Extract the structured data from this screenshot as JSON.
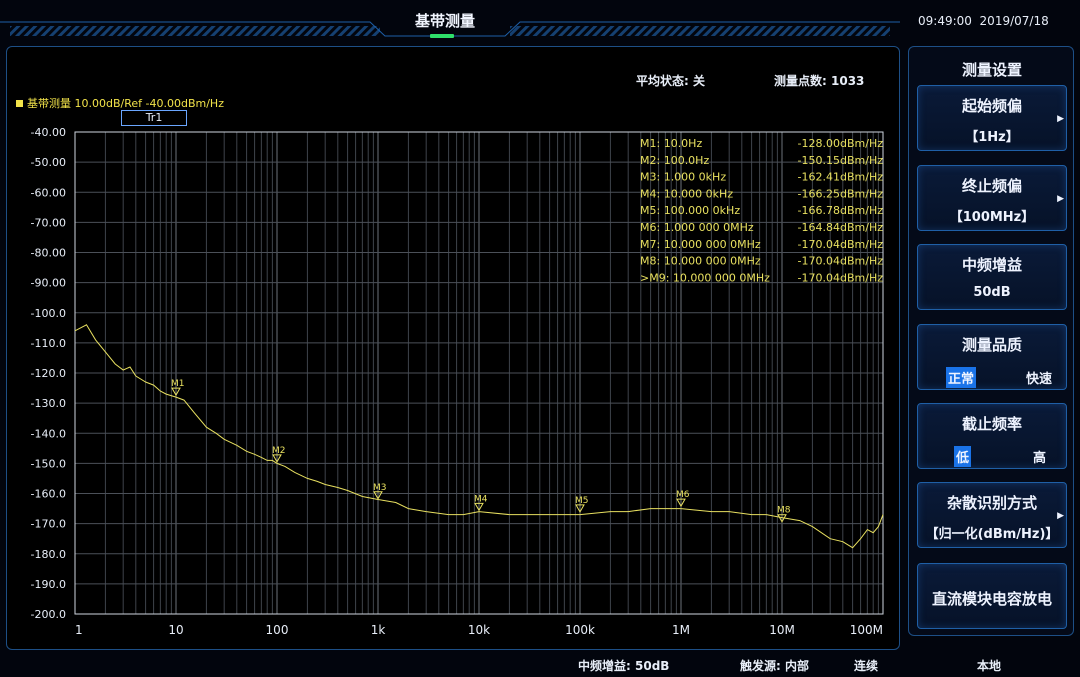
{
  "header": {
    "title": "基带测量",
    "time": "09:49:00",
    "date": "2019/07/18"
  },
  "status": {
    "average_label": "平均状态:",
    "average_value": "关",
    "points_label": "测量点数:",
    "points_value": "1033"
  },
  "chart_label": "基带测量 10.00dB/Ref -40.00dBm/Hz",
  "trace_tag": "Tr1",
  "markers": [
    {
      "prefix": "",
      "name": "M1",
      "freq": "10.0Hz",
      "level": "-128.00dBm/Hz"
    },
    {
      "prefix": "",
      "name": "M2",
      "freq": "100.0Hz",
      "level": "-150.15dBm/Hz"
    },
    {
      "prefix": "",
      "name": "M3",
      "freq": "1.000 0kHz",
      "level": "-162.41dBm/Hz"
    },
    {
      "prefix": "",
      "name": "M4",
      "freq": "10.000 0kHz",
      "level": "-166.25dBm/Hz"
    },
    {
      "prefix": "",
      "name": "M5",
      "freq": "100.000 0kHz",
      "level": "-166.78dBm/Hz"
    },
    {
      "prefix": "",
      "name": "M6",
      "freq": "1.000 000 0MHz",
      "level": "-164.84dBm/Hz"
    },
    {
      "prefix": "",
      "name": "M7",
      "freq": "10.000 000 0MHz",
      "level": "-170.04dBm/Hz"
    },
    {
      "prefix": "",
      "name": "M8",
      "freq": "10.000 000 0MHz",
      "level": "-170.04dBm/Hz"
    },
    {
      "prefix": ">",
      "name": "M9",
      "freq": "10.000 000 0MHz",
      "level": "-170.04dBm/Hz"
    }
  ],
  "chart_data": {
    "type": "line",
    "x_scale": "log",
    "xlim": [
      1,
      100000000
    ],
    "ylim": [
      -200,
      -40
    ],
    "x_ticks": [
      {
        "value": 1,
        "label": "1"
      },
      {
        "value": 10,
        "label": "10"
      },
      {
        "value": 100,
        "label": "100"
      },
      {
        "value": 1000,
        "label": "1k"
      },
      {
        "value": 10000,
        "label": "10k"
      },
      {
        "value": 100000,
        "label": "100k"
      },
      {
        "value": 1000000,
        "label": "1M"
      },
      {
        "value": 10000000,
        "label": "10M"
      },
      {
        "value": 100000000,
        "label": "100M"
      }
    ],
    "y_ticks": [
      {
        "value": -40,
        "label": "-40.00"
      },
      {
        "value": -50,
        "label": "-50.00"
      },
      {
        "value": -60,
        "label": "-60.00"
      },
      {
        "value": -70,
        "label": "-70.00"
      },
      {
        "value": -80,
        "label": "-80.00"
      },
      {
        "value": -90,
        "label": "-90.00"
      },
      {
        "value": -100,
        "label": "-100.0"
      },
      {
        "value": -110,
        "label": "-110.0"
      },
      {
        "value": -120,
        "label": "-120.0"
      },
      {
        "value": -130,
        "label": "-130.0"
      },
      {
        "value": -140,
        "label": "-140.0"
      },
      {
        "value": -150,
        "label": "-150.0"
      },
      {
        "value": -160,
        "label": "-160.0"
      },
      {
        "value": -170,
        "label": "-170.0"
      },
      {
        "value": -180,
        "label": "-180.0"
      },
      {
        "value": -190,
        "label": "-190.0"
      },
      {
        "value": -200,
        "label": "-200.0"
      }
    ],
    "grid": true,
    "series": [
      {
        "color": "#e8e060",
        "x": [
          1,
          1.3,
          1.6,
          2,
          2.5,
          3,
          3.5,
          4,
          5,
          6,
          7,
          8,
          10,
          12,
          15,
          20,
          25,
          30,
          40,
          50,
          60,
          70,
          80,
          90,
          100,
          120,
          150,
          200,
          250,
          300,
          400,
          500,
          700,
          1000,
          1500,
          2000,
          3000,
          5000,
          7000,
          10000,
          20000,
          30000,
          50000,
          100000,
          200000,
          300000,
          500000,
          1000000,
          2000000,
          3000000,
          5000000,
          7000000,
          10000000,
          15000000,
          20000000,
          30000000,
          40000000,
          50000000,
          60000000,
          70000000,
          80000000,
          90000000,
          100000000
        ],
        "y": [
          -106,
          -104,
          -109,
          -113,
          -117,
          -119,
          -118,
          -121,
          -123,
          -124,
          -126,
          -127,
          -128,
          -129,
          -133,
          -138,
          -140,
          -142,
          -144,
          -146,
          -147,
          -148,
          -149,
          -149,
          -150,
          -151,
          -153,
          -155,
          -156,
          -157,
          -158,
          -159,
          -161,
          -162,
          -163,
          -165,
          -166,
          -167,
          -167,
          -166,
          -167,
          -167,
          -167,
          -167,
          -166,
          -166,
          -165,
          -165,
          -166,
          -166,
          -167,
          -167,
          -168,
          -169,
          -171,
          -175,
          -176,
          -178,
          -175,
          -172,
          -173,
          -171,
          -167
        ]
      }
    ],
    "marker_points": [
      {
        "name": "M1",
        "x": 10,
        "y": -128
      },
      {
        "name": "M2",
        "x": 100,
        "y": -150.15
      },
      {
        "name": "M3",
        "x": 1000,
        "y": -162.41
      },
      {
        "name": "M4",
        "x": 10000,
        "y": -166.25
      },
      {
        "name": "M5",
        "x": 100000,
        "y": -166.78
      },
      {
        "name": "M6",
        "x": 1000000,
        "y": -164.84
      },
      {
        "name": "M8",
        "x": 10000000,
        "y": -170.04
      }
    ]
  },
  "settings": {
    "title": "测量设置",
    "start_offset": {
      "label": "起始频偏",
      "value": "【1Hz】"
    },
    "stop_offset": {
      "label": "终止频偏",
      "value": "【100MHz】"
    },
    "if_gain": {
      "label": "中频增益",
      "value": "50dB"
    },
    "quality": {
      "label": "测量品质",
      "opt1": "正常",
      "opt2": "快速"
    },
    "cutoff": {
      "label": "截止频率",
      "opt1": "低",
      "opt2": "高"
    },
    "spur_mode": {
      "label": "杂散识别方式",
      "value": "【归一化(dBm/Hz)】"
    },
    "dc_discharge": {
      "label": "直流模块电容放电"
    }
  },
  "footer": {
    "if_gain_label": "中频增益:",
    "if_gain_value": "50dB",
    "trigger_label": "触发源:",
    "trigger_value": "内部",
    "mode": "连续",
    "local": "本地"
  }
}
